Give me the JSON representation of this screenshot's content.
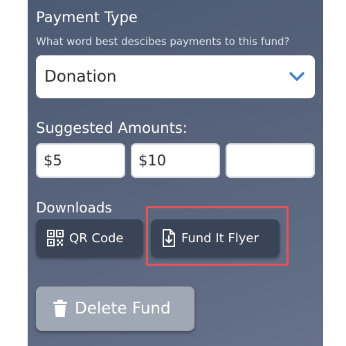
{
  "payment_type": {
    "label": "Payment Type",
    "help": "What word best descibes payments to this fund?",
    "selected": "Donation"
  },
  "suggested": {
    "label": "Suggested Amounts:",
    "amounts": [
      "$5",
      "$10",
      ""
    ]
  },
  "downloads": {
    "label": "Downloads",
    "qr_label": "QR Code",
    "flyer_label": "Fund It Flyer"
  },
  "delete_label": "Delete Fund",
  "colors": {
    "panel": "#56637a",
    "chevron": "#3d7fc9",
    "highlight": "#e8525a",
    "download_button": "#3a4457",
    "delete_button": "#9fa8b4"
  },
  "icons": {
    "select": "chevron-down-icon",
    "qr": "qr-code-icon",
    "flyer": "file-download-icon",
    "delete": "trash-icon"
  }
}
